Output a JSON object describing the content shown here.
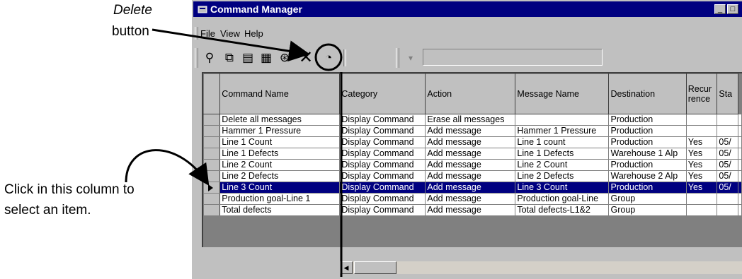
{
  "annotations": {
    "delete_line1": "Delete",
    "delete_line2": "button",
    "click_line1": "Click in this column to",
    "click_line2": "select an item."
  },
  "window": {
    "title": "Command Manager",
    "title_bar_color": "#000080",
    "menu": [
      "File",
      "View",
      "Help"
    ]
  },
  "toolbar": {
    "icons": [
      "new-command-icon",
      "copy-icon",
      "properties-icon",
      "edit-icon",
      "send-icon",
      "delete-icon",
      "schedule-icon",
      "find-icon"
    ]
  },
  "grid": {
    "columns": [
      "Command Name",
      "Category",
      "Action",
      "Message Name",
      "Destination",
      "Recur rence",
      "Sta"
    ],
    "rows": [
      [
        "Delete all messages",
        "Display Command",
        "Erase all messages",
        "",
        "Production",
        "",
        ""
      ],
      [
        "Hammer 1 Pressure",
        "Display Command",
        "Add message",
        "Hammer 1 Pressure",
        "Production",
        "",
        ""
      ],
      [
        "Line 1 Count",
        "Display Command",
        "Add message",
        "Line 1 count",
        "Production",
        "Yes",
        "05/"
      ],
      [
        "Line 1 Defects",
        "Display Command",
        "Add message",
        "Line 1 Defects",
        "Warehouse 1 Alp",
        "Yes",
        "05/"
      ],
      [
        "Line 2 Count",
        "Display Command",
        "Add message",
        "Line 2 Count",
        "Production",
        "Yes",
        "05/"
      ],
      [
        "Line 2 Defects",
        "Display Command",
        "Add message",
        "Line 2 Defects",
        "Warehouse 2 Alp",
        "Yes",
        "05/"
      ],
      [
        "Line 3 Count",
        "Display Command",
        "Add message",
        "Line 3 Count",
        "Production",
        "Yes",
        "05/"
      ],
      [
        "Production goal-Line 1",
        "Display Command",
        "Add message",
        "Production goal-Line",
        "Group",
        "",
        ""
      ],
      [
        "Total defects",
        "Display Command",
        "Add message",
        "Total defects-L1&2",
        "Group",
        "",
        ""
      ]
    ],
    "selected_row_index": 6,
    "selection_color": "#000080"
  }
}
